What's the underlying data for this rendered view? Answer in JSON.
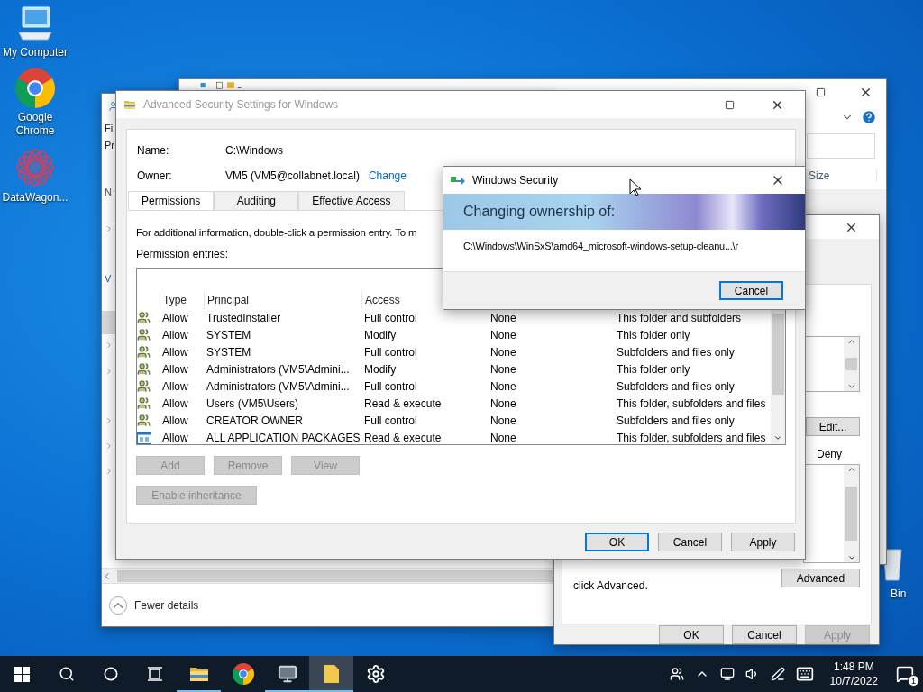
{
  "desktop_icons": [
    {
      "kind": "computer",
      "label": "My Computer"
    },
    {
      "kind": "chrome",
      "label": "Google Chrome"
    },
    {
      "kind": "datawagon",
      "label": "DataWagon..."
    }
  ],
  "recycle_bin": {
    "label": "Bin"
  },
  "explorer": {
    "column_header": "Size"
  },
  "task_manager": {
    "menu_cut": "Fi",
    "tab_cut": "Pr",
    "header_cut": "N",
    "group_cut": "V",
    "footer_link": "Fewer details"
  },
  "properties": {
    "edit_button": "Edit...",
    "column_header": "Deny",
    "note": "click Advanced.",
    "advanced_button": "Advanced",
    "buttons": [
      {
        "label": "OK",
        "disabled": false
      },
      {
        "label": "Cancel",
        "disabled": false
      },
      {
        "label": "Apply",
        "disabled": true
      }
    ]
  },
  "advanced_security": {
    "title": "Advanced Security Settings for Windows",
    "name_label": "Name:",
    "name_value": "C:\\Windows",
    "owner_label": "Owner:",
    "owner_value": "VM5 (VM5@collabnet.local)",
    "change_link": "Change",
    "tabs": [
      {
        "label": "Permissions",
        "selected": true
      },
      {
        "label": "Auditing",
        "selected": false
      },
      {
        "label": "Effective Access",
        "selected": false
      }
    ],
    "info": "For additional information, double-click a permission entry. To m",
    "entries_label": "Permission entries:",
    "columns": [
      "Type",
      "Principal",
      "Access"
    ],
    "rows": [
      {
        "kind": "user",
        "type": "Allow",
        "principal": "TrustedInstaller",
        "access": "Full control",
        "column_4": "None",
        "column_5": "This folder and subfolders"
      },
      {
        "kind": "user",
        "type": "Allow",
        "principal": "SYSTEM",
        "access": "Modify",
        "column_4": "None",
        "column_5": "This folder only"
      },
      {
        "kind": "user",
        "type": "Allow",
        "principal": "SYSTEM",
        "access": "Full control",
        "column_4": "None",
        "column_5": "Subfolders and files only"
      },
      {
        "kind": "user",
        "type": "Allow",
        "principal": "Administrators (VM5\\Admini...",
        "access": "Modify",
        "column_4": "None",
        "column_5": "This folder only"
      },
      {
        "kind": "user",
        "type": "Allow",
        "principal": "Administrators (VM5\\Admini...",
        "access": "Full control",
        "column_4": "None",
        "column_5": "Subfolders and files only"
      },
      {
        "kind": "user",
        "type": "Allow",
        "principal": "Users (VM5\\Users)",
        "access": "Read & execute",
        "column_4": "None",
        "column_5": "This folder, subfolders and files"
      },
      {
        "kind": "user",
        "type": "Allow",
        "principal": "CREATOR OWNER",
        "access": "Full control",
        "column_4": "None",
        "column_5": "Subfolders and files only"
      },
      {
        "kind": "package",
        "type": "Allow",
        "principal": "ALL APPLICATION PACKAGES",
        "access": "Read & execute",
        "column_4": "None",
        "column_5": "This folder, subfolders and files"
      }
    ],
    "entry_buttons": [
      {
        "label": "Add",
        "disabled": true
      },
      {
        "label": "Remove",
        "disabled": true
      },
      {
        "label": "View",
        "disabled": true
      }
    ],
    "inheritance_button": {
      "label": "Enable inheritance",
      "disabled": true
    },
    "buttons": [
      {
        "label": "OK",
        "default": true
      },
      {
        "label": "Cancel",
        "default": false
      },
      {
        "label": "Apply",
        "default": false
      }
    ]
  },
  "windows_security": {
    "title": "Windows Security",
    "heading": "Changing ownership of:",
    "path": "C:\\Windows\\WinSxS\\amd64_microsoft-windows-setup-cleanu...\\r",
    "cancel": "Cancel"
  },
  "taskbar": {
    "apps": [
      {
        "kind": "explorer",
        "open": true,
        "active": false
      },
      {
        "kind": "chrome",
        "open": false,
        "active": false
      },
      {
        "kind": "monitor",
        "open": true,
        "active": false
      },
      {
        "kind": "file",
        "open": true,
        "active": true
      },
      {
        "kind": "settings",
        "open": false,
        "active": false
      }
    ],
    "time": "1:48 PM",
    "date": "10/7/2022",
    "notification_count": "1"
  }
}
